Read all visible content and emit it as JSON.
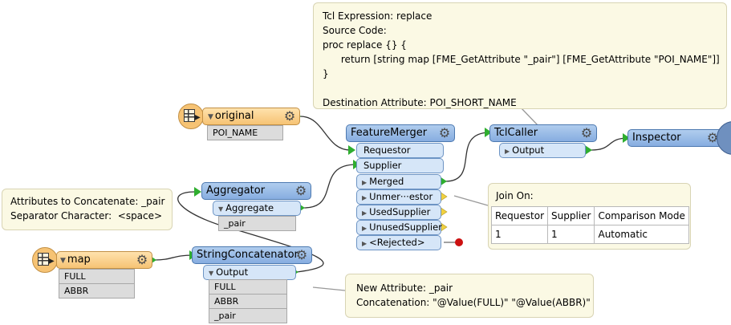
{
  "notes": {
    "tcl": {
      "lines": [
        "Tcl Expression: replace",
        "Source Code:",
        "proc replace {} {",
        "      return [string map [FME_GetAttribute \"_pair\"] [FME_GetAttribute \"POI_NAME\"]]",
        "}",
        "",
        "Destination Attribute: POI_SHORT_NAME"
      ]
    },
    "aggregate": {
      "lines": [
        "Attributes to Concatenate: _pair",
        "Separator Character:  <space>"
      ]
    },
    "join": {
      "title": "Join On:",
      "headers": [
        "Requestor",
        "Supplier",
        "Comparison Mode"
      ],
      "row": [
        "1",
        "1",
        "Automatic"
      ]
    },
    "concat": {
      "lines": [
        "New Attribute: _pair",
        "Concatenation: \"@Value(FULL)\" \"@Value(ABBR)\""
      ]
    }
  },
  "readers": {
    "original": {
      "name": "original",
      "attrs": [
        "POI_NAME"
      ]
    },
    "map": {
      "name": "map",
      "attrs": [
        "FULL",
        "ABBR"
      ]
    }
  },
  "transformers": {
    "aggregator": {
      "name": "Aggregator",
      "outputs": [
        "Aggregate"
      ],
      "attrs": [
        "_pair"
      ]
    },
    "concatenator": {
      "name": "StringConcatenator",
      "outputs": [
        "Output"
      ],
      "attrs": [
        "FULL",
        "ABBR",
        "_pair"
      ]
    },
    "merger": {
      "name": "FeatureMerger",
      "inputs": [
        "Requestor",
        "Supplier"
      ],
      "outputs": [
        "Merged",
        "Unmer···estor",
        "UsedSupplier",
        "UnusedSupplier",
        "<Rejected>"
      ]
    },
    "tclcaller": {
      "name": "TclCaller",
      "outputs": [
        "Output"
      ]
    },
    "inspector": {
      "name": "Inspector"
    }
  },
  "icons": {
    "gear": "gear-icon",
    "table_reader": "table-reader-icon",
    "collapse_triangle": "triangle-down-icon",
    "output_triangle": "triangle-right-icon",
    "magnifier": "magnifier-icon"
  },
  "colors": {
    "transformer": "#87ade0",
    "reader": "#f6c374",
    "port": "#d6e6f8",
    "attribute": "#dcdcdc",
    "note": "#fbf9e4",
    "connected_port": "#2fae2f",
    "unconnected_port": "#f0d040",
    "rejected_port": "#cc1111",
    "wire": "#333333"
  }
}
